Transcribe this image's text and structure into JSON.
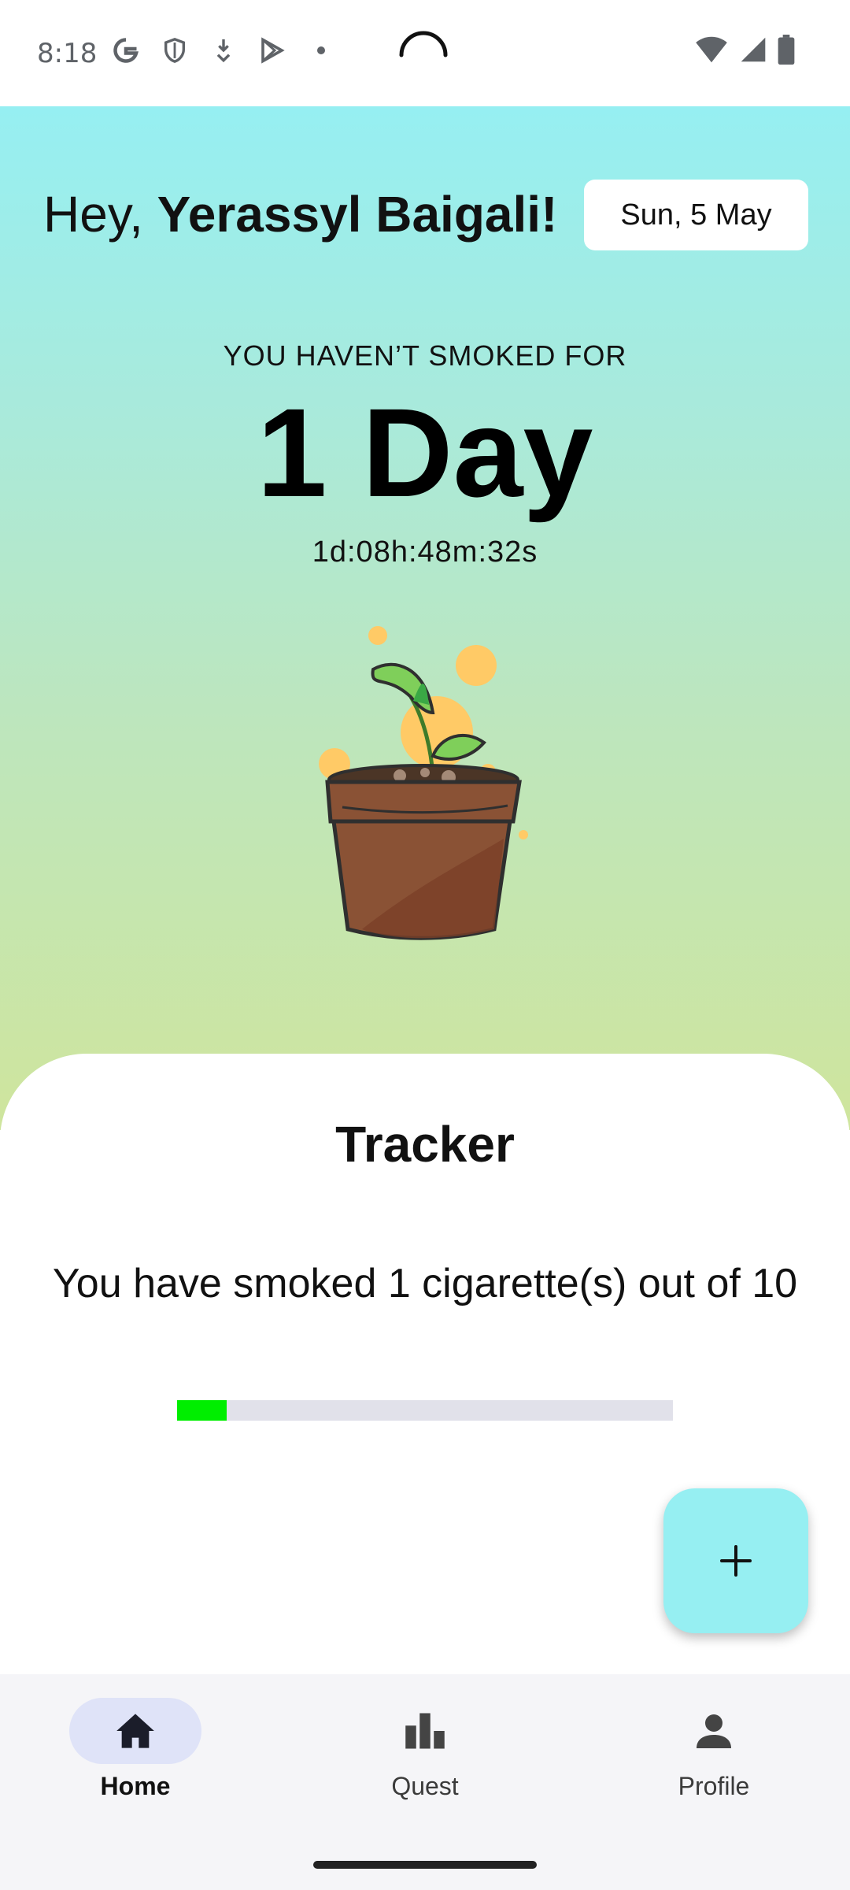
{
  "status_bar": {
    "time": "8:18",
    "left_icons": [
      "google-g-icon",
      "shield-icon",
      "download-icon",
      "play-store-icon",
      "notification-dot-icon"
    ],
    "right_icons": [
      "wifi-icon",
      "signal-icon",
      "battery-icon"
    ]
  },
  "header": {
    "greeting_prefix": "Hey, ",
    "user_name": "Yerassyl Baigali!",
    "date": "Sun, 5 May"
  },
  "streak": {
    "label": "YOU HAVEN’T SMOKED FOR",
    "value": "1 Day",
    "timer": "1d:08h:48m:32s"
  },
  "tracker": {
    "title": "Tracker",
    "summary": "You have smoked 1 cigarette(s) out of 10",
    "smoked": 1,
    "limit": 10,
    "progress_color": "#00ee00"
  },
  "fab": {
    "icon": "plus-icon",
    "label": "+"
  },
  "bottom_nav": {
    "items": [
      {
        "label": "Home",
        "icon": "home-icon",
        "active": true
      },
      {
        "label": "Quest",
        "icon": "bar-chart-icon",
        "active": false
      },
      {
        "label": "Profile",
        "icon": "person-icon",
        "active": false
      }
    ]
  },
  "colors": {
    "gradient_top": "#96eff2",
    "gradient_bottom": "#cfe59d",
    "fab_bg": "#96eff2",
    "nav_active_pill": "#dfe3f8"
  }
}
